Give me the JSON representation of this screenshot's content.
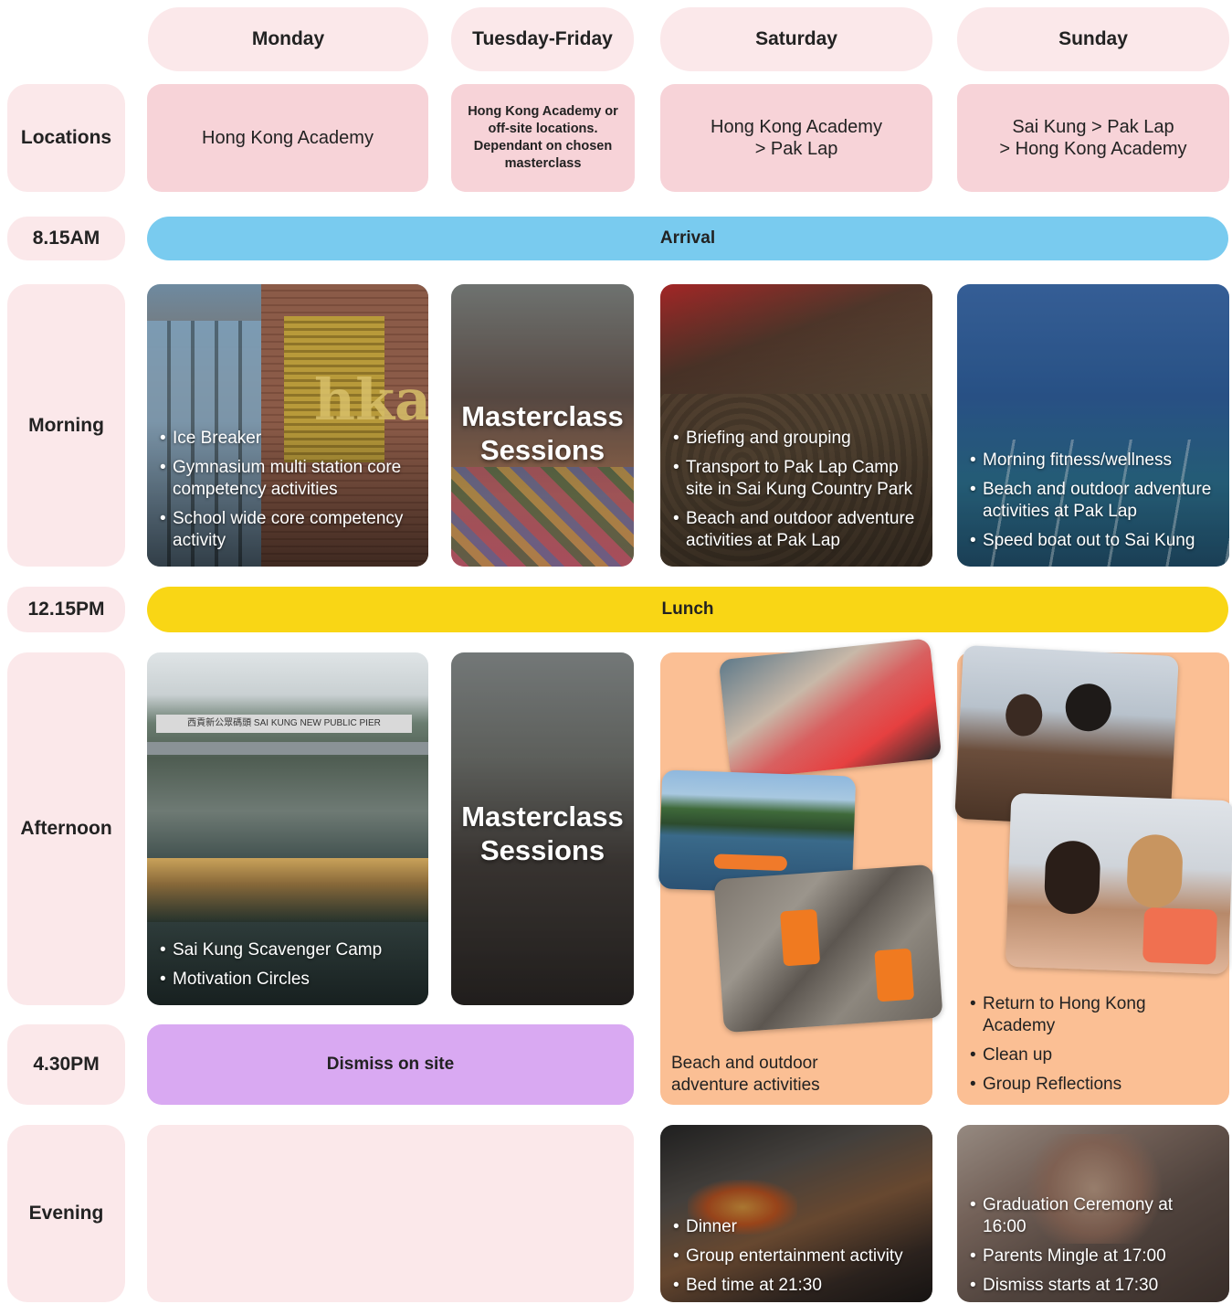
{
  "days": [
    "Monday",
    "Tuesday-Friday",
    "Saturday",
    "Sunday"
  ],
  "rows": {
    "locations": "Locations",
    "time_arrival": "8.15AM",
    "morning": "Morning",
    "time_lunch": "12.15PM",
    "afternoon": "Afternoon",
    "time_dismiss": "4.30PM",
    "evening": "Evening"
  },
  "locations": {
    "monday": "Hong Kong Academy",
    "tuesday_friday": "Hong Kong Academy or off-site locations. Dependant on chosen masterclass",
    "saturday_line1": "Hong Kong Academy",
    "saturday_line2": "> Pak Lap",
    "sunday_line1": "Sai Kung > Pak Lap",
    "sunday_line2": "> Hong Kong Academy"
  },
  "bars": {
    "arrival": "Arrival",
    "lunch": "Lunch",
    "dismiss": "Dismiss on site"
  },
  "morning": {
    "monday": [
      "Ice Breaker",
      "Gymnasium multi station core competency activities",
      "School wide core competency activity"
    ],
    "tuesday_friday_line1": "Masterclass",
    "tuesday_friday_line2": "Sessions",
    "saturday": [
      "Briefing and grouping",
      "Transport to Pak Lap Camp site in Sai Kung Country Park",
      "Beach and outdoor adventure activities at Pak Lap"
    ],
    "sunday": [
      "Morning fitness/wellness",
      "Beach and outdoor adventure activities at Pak Lap",
      "Speed boat out to Sai Kung"
    ]
  },
  "afternoon": {
    "monday": [
      "Sai Kung Scavenger Camp",
      "Motivation Circles"
    ],
    "monday_sign": "西貢新公眾碼頭  SAI KUNG NEW PUBLIC PIER",
    "tuesday_friday_line1": "Masterclass",
    "tuesday_friday_line2": "Sessions",
    "saturday_line1": "Beach and outdoor",
    "saturday_line2": "adventure activities",
    "sunday": [
      "Return to Hong Kong Academy",
      "Clean up",
      "Group Reflections"
    ]
  },
  "evening": {
    "saturday": [
      "Dinner",
      "Group entertainment activity",
      "Bed time at 21:30"
    ],
    "sunday": [
      "Graduation Ceremony at 16:00",
      "Parents Mingle at 17:00",
      "Dismiss starts at 17:30"
    ]
  },
  "colors": {
    "header_bg": "#fbe8ea",
    "location_bg": "#f7d3d8",
    "arrival": "#79cbef",
    "lunch": "#f9d615",
    "dismiss": "#d9a9f2",
    "peach": "#fbbf94"
  },
  "icons": {
    "building_sign": "hka-sign"
  }
}
